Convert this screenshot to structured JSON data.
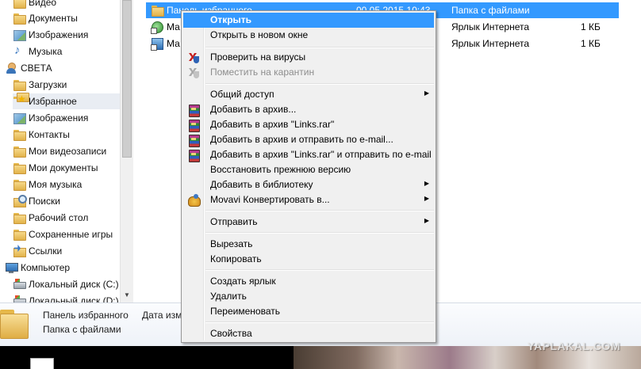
{
  "navigation": {
    "items": [
      {
        "label": "Видео",
        "icon": "video-library-icon"
      },
      {
        "label": "Документы",
        "icon": "documents-library-icon"
      },
      {
        "label": "Изображения",
        "icon": "pictures-library-icon"
      },
      {
        "label": "Музыка",
        "icon": "music-library-icon"
      },
      {
        "label": "СВЕТА",
        "icon": "user-folder-icon"
      },
      {
        "label": "Загрузки",
        "icon": "downloads-folder-icon"
      },
      {
        "label": "Избранное",
        "icon": "favorites-folder-icon"
      },
      {
        "label": "Изображения",
        "icon": "pictures-folder-icon"
      },
      {
        "label": "Контакты",
        "icon": "contacts-folder-icon"
      },
      {
        "label": "Мои видеозаписи",
        "icon": "videos-folder-icon"
      },
      {
        "label": "Мои документы",
        "icon": "documents-folder-icon"
      },
      {
        "label": "Моя музыка",
        "icon": "music-folder-icon"
      },
      {
        "label": "Поиски",
        "icon": "searches-folder-icon"
      },
      {
        "label": "Рабочий стол",
        "icon": "desktop-folder-icon"
      },
      {
        "label": "Сохраненные игры",
        "icon": "saved-games-folder-icon"
      },
      {
        "label": "Ссылки",
        "icon": "links-folder-icon"
      },
      {
        "label": "Компьютер",
        "icon": "computer-icon"
      },
      {
        "label": "Локальный диск (C:)",
        "icon": "local-disk-icon"
      },
      {
        "label": "Локальный диск (D:)",
        "icon": "local-disk-icon"
      }
    ]
  },
  "files": [
    {
      "name": "Панель избранного",
      "date": "00.05.2015 10:43",
      "type": "Папка с файлами",
      "size": "",
      "icon": "folder-icon",
      "selected": true
    },
    {
      "name": "Ма",
      "date": "",
      "type": "Ярлык Интернета",
      "size": "1 КБ",
      "icon": "internet-shortcut-icon",
      "selected": false
    },
    {
      "name": "Ма",
      "date": "",
      "type": "Ярлык Интернета",
      "size": "1 КБ",
      "icon": "internet-shortcut-icon",
      "selected": false
    }
  ],
  "context_menu": {
    "open": "Открыть",
    "open_new_window": "Открыть в новом окне",
    "scan_virus": "Проверить на вирусы",
    "quarantine": "Поместить на карантин",
    "share": "Общий доступ",
    "add_archive": "Добавить в архив...",
    "add_links_rar": "Добавить в архив \"Links.rar\"",
    "add_archive_email": "Добавить в архив и отправить по e-mail...",
    "add_links_rar_email": "Добавить в архив \"Links.rar\" и отправить по e-mail",
    "restore_previous": "Восстановить прежнюю версию",
    "add_library": "Добавить в библиотеку",
    "movavi_convert": "Movavi Конвертировать в...",
    "send_to": "Отправить",
    "cut": "Вырезать",
    "copy": "Копировать",
    "create_shortcut": "Создать ярлык",
    "delete": "Удалить",
    "rename": "Переименовать",
    "properties": "Свойства",
    "submenu_arrow": "▶"
  },
  "details": {
    "name": "Панель избранного",
    "date_label": "Дата изм",
    "type": "Папка с файлами"
  },
  "watermark": "YAPLAKAL.COM",
  "colors": {
    "selection": "#3399ff",
    "menu_background": "#f0f0f0",
    "disabled_text": "#8d8d8d"
  }
}
